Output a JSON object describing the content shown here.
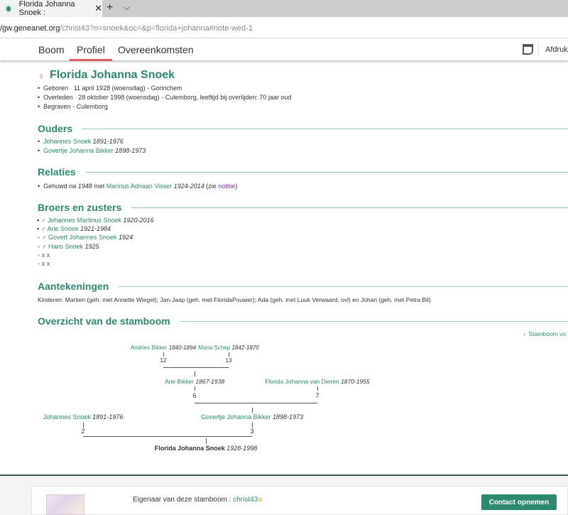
{
  "browser": {
    "tab_title": "Florida Johanna Snoek :",
    "url_host": "/gw.geneanet.org",
    "url_path": "/christ43?n=snoek&oc=&p=florida+johanna#note-wed-1"
  },
  "nav": {
    "tabs": [
      "Boom",
      "Profiel",
      "Overeenkomsten"
    ],
    "active": "Profiel",
    "print_label": "Afdrukl"
  },
  "person": {
    "name": "Florida Johanna Snoek",
    "facts": [
      {
        "label": "Geboren",
        "value": "11 april 1928 (woensdag) - Gorinchem"
      },
      {
        "label": "Overleden",
        "value": "28 oktober 1998 (woensdag) - Culemborg, leeftijd bij overlijden: 70 jaar oud"
      },
      {
        "label": "Begraven",
        "value": "- Culemborg"
      }
    ]
  },
  "parents": {
    "heading": "Ouders",
    "items": [
      {
        "name": "Johannes Snoek",
        "dates": "1891-1976"
      },
      {
        "name": "Govertje Johanna Bikker",
        "dates": "1898-1973"
      }
    ]
  },
  "relations": {
    "heading": "Relaties",
    "pre": "Gehuwd",
    "when": "na 1948",
    "with": "met",
    "spouse": "Marinus Adriaan Visser",
    "dates": "1924-2014",
    "note_pre": "(zie",
    "note_link": "notitie",
    "note_post": ")"
  },
  "siblings": {
    "heading": "Broers en zusters",
    "items": [
      {
        "name": "Johannes Martinus Snoek",
        "dates": "1920-2016"
      },
      {
        "name": "Arie Snoek",
        "dates": "1921-1984"
      },
      {
        "name": "Govert Johannes Snoek",
        "dates": "1924"
      },
      {
        "name": "Hans Snoek",
        "dates": "1925"
      },
      {
        "name": "x x"
      },
      {
        "name": "x x"
      }
    ]
  },
  "notes": {
    "heading": "Aantekeningen",
    "text": "Kinderen: Martien (geh. met Annette Wiegel); Jan-Jaap (geh. met FloridaPouwer); Ada (geh. met Luuk Verwaard, ovl) en Johan (geh. met Petra Bil)"
  },
  "tree": {
    "heading": "Overzicht van de stamboom",
    "link": "Stamboom vo",
    "people": {
      "p12": {
        "name": "Andries Bikker",
        "dates": "1840-1894",
        "num": "12"
      },
      "p13": {
        "name": "Maria Schep",
        "dates": "1842-1870",
        "num": "13"
      },
      "p6": {
        "name": "Arie Bikker",
        "dates": "1867-1938",
        "num": "6"
      },
      "p7": {
        "name": "Florida Johanna van Dieren",
        "dates": "1870-1955",
        "num": "7"
      },
      "p2": {
        "name": "Johannes Snoek",
        "dates": "1891-1976",
        "num": "2"
      },
      "p3": {
        "name": "Govertje Johanna Bikker",
        "dates": "1898-1973",
        "num": "3"
      },
      "p1": {
        "name": "Florida Johanna Snoek",
        "dates": "1928-1998"
      }
    }
  },
  "footer": {
    "owner_label": "Eigenaar van deze stamboom :",
    "owner": "christ43",
    "contact": "Contact opnemen"
  }
}
